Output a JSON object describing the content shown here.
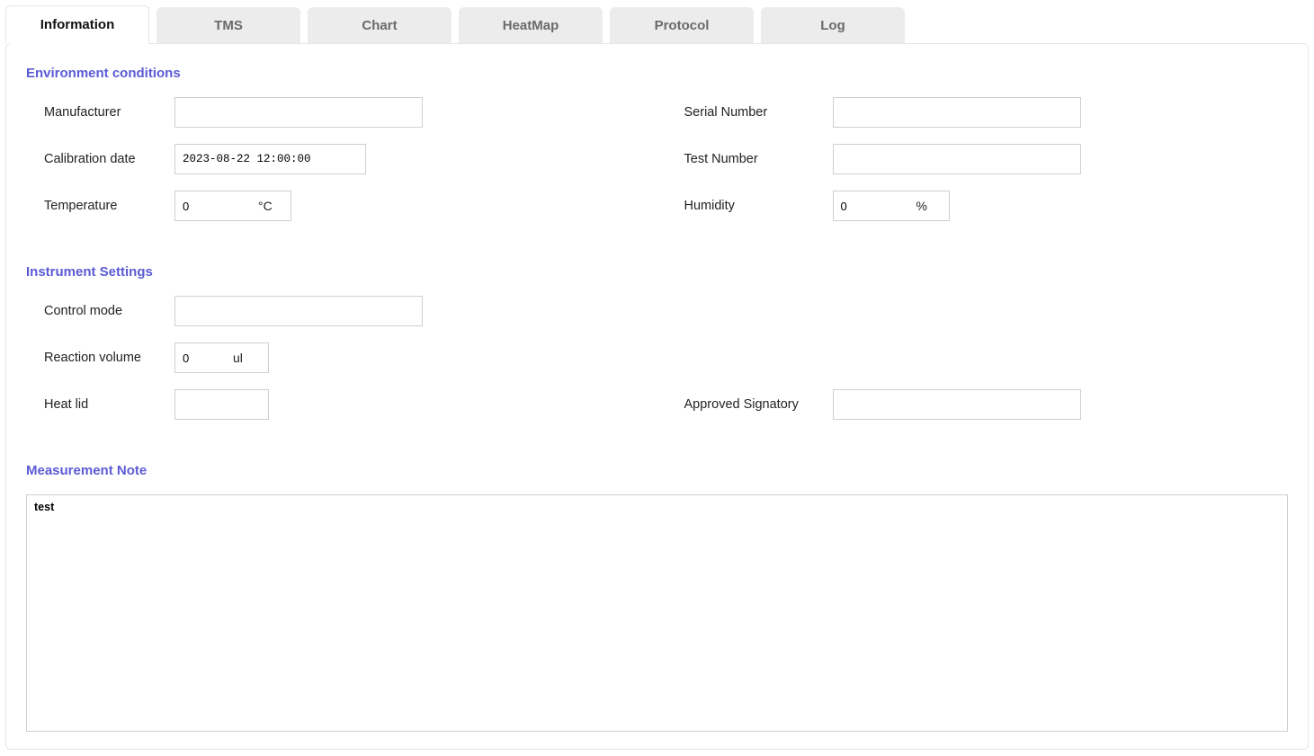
{
  "tabs": {
    "items": [
      {
        "label": "Information",
        "active": true
      },
      {
        "label": "TMS",
        "active": false
      },
      {
        "label": "Chart",
        "active": false
      },
      {
        "label": "HeatMap",
        "active": false
      },
      {
        "label": "Protocol",
        "active": false
      },
      {
        "label": "Log",
        "active": false
      }
    ]
  },
  "sections": {
    "env": {
      "title": "Environment conditions",
      "manufacturer": {
        "label": "Manufacturer",
        "value": ""
      },
      "serial_number": {
        "label": "Serial Number",
        "value": ""
      },
      "calibration_date": {
        "label": "Calibration date",
        "value": "2023-08-22 12:00:00"
      },
      "test_number": {
        "label": "Test Number",
        "value": ""
      },
      "temperature": {
        "label": "Temperature",
        "value": "0",
        "unit": "°C"
      },
      "humidity": {
        "label": "Humidity",
        "value": "0",
        "unit": "%"
      }
    },
    "instrument": {
      "title": "Instrument Settings",
      "control_mode": {
        "label": "Control mode",
        "value": ""
      },
      "reaction_volume": {
        "label": "Reaction volume",
        "value": "0",
        "unit": "ul"
      },
      "heat_lid": {
        "label": "Heat lid",
        "value": ""
      },
      "approved_signatory": {
        "label": "Approved Signatory",
        "value": ""
      }
    },
    "note": {
      "title": "Measurement Note",
      "value": "test"
    }
  }
}
